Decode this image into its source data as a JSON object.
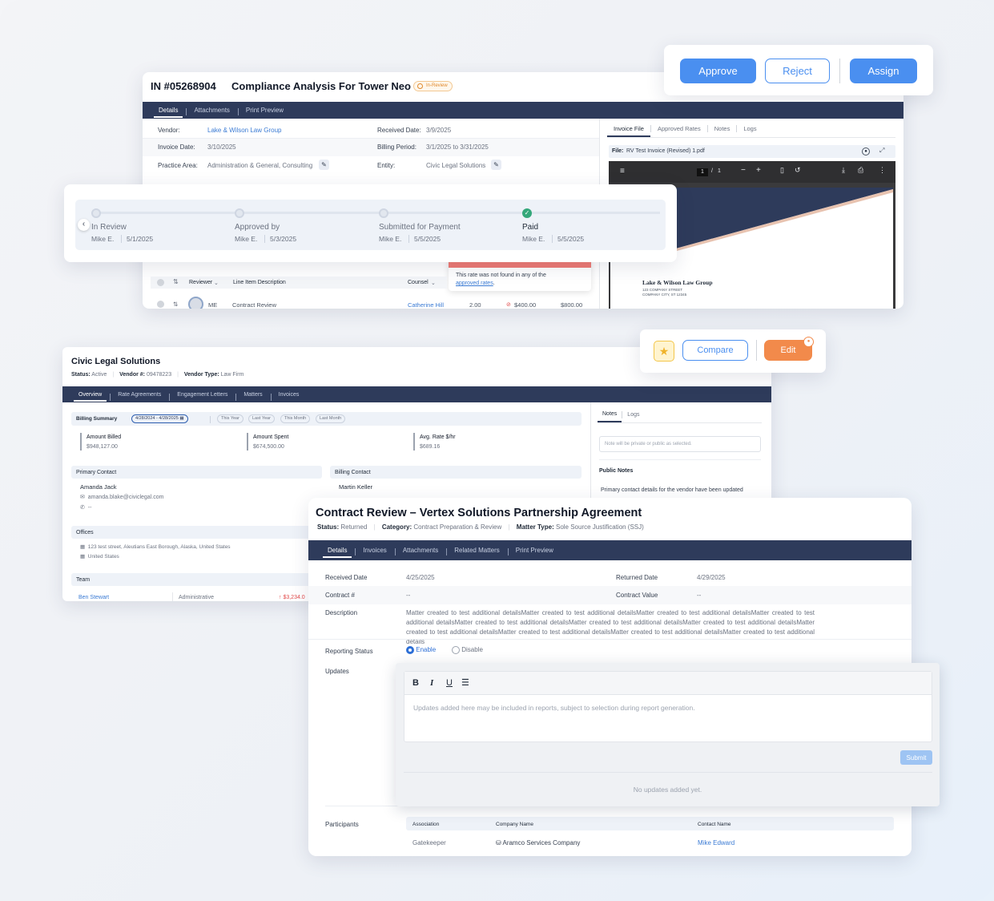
{
  "invoice": {
    "id": "IN #05268904",
    "title": "Compliance Analysis For Tower Neo",
    "status": "In-Review",
    "tabs": [
      "Details",
      "Attachments",
      "Print Preview"
    ],
    "fields": {
      "vendor_label": "Vendor:",
      "vendor": "Lake & Wilson Law Group",
      "received_label": "Received Date:",
      "received": "3/9/2025",
      "invoice_date_label": "Invoice Date:",
      "invoice_date": "3/10/2025",
      "billing_period_label": "Billing Period:",
      "billing_period": "3/1/2025 to 3/31/2025",
      "practice_label": "Practice Area:",
      "practice": "Administration & General, Consulting",
      "entity_label": "Entity:",
      "entity": "Civic Legal Solutions"
    },
    "right_tabs": [
      "Invoice File",
      "Approved Rates",
      "Notes",
      "Logs"
    ],
    "file_label": "File:",
    "file_name": "RV Test Invoice (Revised) 1.pdf",
    "pdf": {
      "page_current": "1",
      "page_total": "1",
      "firm": "Lake & Wilson Law Group",
      "street": "123 COMPANY STREET",
      "city": "COMPANY CITY, ST 12345"
    },
    "tooltip": {
      "text": "This rate was not found in any of the",
      "link": "approved rates",
      "end": "."
    },
    "table": {
      "headers": {
        "reviewer": "Reviewer",
        "description": "Line Item Description",
        "counsel": "Counsel"
      },
      "row": {
        "initials": "ME",
        "description": "Contract Review",
        "counsel": "Catherine Hill",
        "qty": "2.00",
        "rate": "$400.00",
        "amount": "$800.00"
      }
    }
  },
  "actions": {
    "approve": "Approve",
    "reject": "Reject",
    "assign": "Assign"
  },
  "timeline": [
    {
      "label": "In Review",
      "by": "Mike E.",
      "date": "5/1/2025",
      "done": false
    },
    {
      "label": "Approved by",
      "by": "Mike E.",
      "date": "5/3/2025",
      "done": false
    },
    {
      "label": "Submitted for Payment",
      "by": "Mike E.",
      "date": "5/5/2025",
      "done": false
    },
    {
      "label": "Paid",
      "by": "Mike E.",
      "date": "5/5/2025",
      "done": true
    }
  ],
  "vendor": {
    "name": "Civic Legal Solutions",
    "status_label": "Status:",
    "status": "Active",
    "vendor_no_label": "Vendor #:",
    "vendor_no": "09478223",
    "type_label": "Vendor Type:",
    "type": "Law Firm",
    "tabs": [
      "Overview",
      "Rate Agreements",
      "Engagement Letters",
      "Matters",
      "Invoices"
    ],
    "billing": {
      "title": "Billing Summary",
      "range": "4/28/2024 - 4/28/2025",
      "filters": [
        "This Year",
        "Last Year",
        "This Month",
        "Last Month"
      ],
      "stats": [
        {
          "label": "Amount Billed",
          "value": "$948,127.00"
        },
        {
          "label": "Amount Spent",
          "value": "$674,500.00"
        },
        {
          "label": "Avg. Rate $/hr",
          "value": "$689.16"
        }
      ]
    },
    "primary_contact": {
      "title": "Primary Contact",
      "name": "Amanda Jack",
      "email": "amanda.blake@civiclegal.com",
      "phone": "--"
    },
    "billing_contact": {
      "title": "Billing Contact",
      "name": "Martin Keller"
    },
    "offices": {
      "title": "Offices",
      "lines": [
        "123 test street, Aleutians East Borough, Alaska, United States",
        "United States"
      ]
    },
    "team": {
      "title": "Team",
      "member": "Ben Stewart",
      "role": "Administrative",
      "amount": "↑ $3,234.0"
    },
    "notes_tabs": [
      "Notes",
      "Logs"
    ],
    "note_placeholder": "Note will be private or public as selected.",
    "public_notes_title": "Public Notes",
    "public_note": "Primary contact details for the vendor have been updated"
  },
  "vendor_actions": {
    "compare": "Compare",
    "edit": "Edit"
  },
  "matter": {
    "title": "Contract Review – Vertex Solutions Partnership Agreement",
    "status_label": "Status:",
    "status": "Returned",
    "category_label": "Category:",
    "category": "Contract Preparation & Review",
    "type_label": "Matter Type:",
    "type": "Sole Source Justification (SSJ)",
    "tabs": [
      "Details",
      "Invoices",
      "Attachments",
      "Related Matters",
      "Print Preview"
    ],
    "received_label": "Received Date",
    "received": "4/25/2025",
    "returned_label": "Returned Date",
    "returned": "4/29/2025",
    "contract_no_label": "Contract #",
    "contract_no": "--",
    "contract_value_label": "Contract Value",
    "contract_value": "--",
    "description_label": "Description",
    "description": "Matter created to test additional detailsMatter created to test additional detailsMatter created to test additional detailsMatter created to test additional detailsMatter created to test additional detailsMatter created to test additional detailsMatter created to test additional detailsMatter created to test additional detailsMatter created to test additional detailsMatter created to test additional detailsMatter created to test additional details",
    "reporting_label": "Reporting Status",
    "enable": "Enable",
    "disable": "Disable",
    "updates_label": "Updates",
    "editor_placeholder": "Updates added here may be included in reports, subject to selection during report generation.",
    "submit": "Submit",
    "no_updates": "No updates added yet.",
    "participants_label": "Participants",
    "participants_headers": [
      "Association",
      "Company Name",
      "Contact Name"
    ],
    "participant": {
      "association": "Gatekeeper",
      "company": "Aramco Services Company",
      "contact": "Mike Edward"
    }
  },
  "colors": {
    "nav": "#2e3b5b",
    "primary": "#4a8ff0",
    "accent": "#f28a4b",
    "success": "#34a77a"
  }
}
